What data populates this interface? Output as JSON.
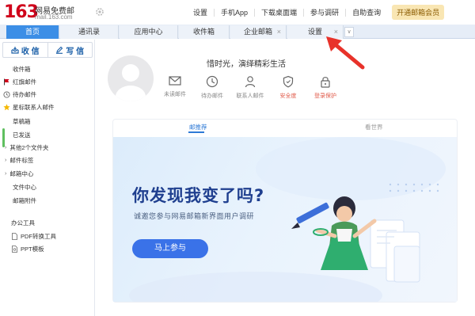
{
  "header": {
    "logo_number": "163",
    "logo_name": "网易免费邮",
    "logo_domain": "mail.163.com",
    "nav": [
      "设置",
      "手机App",
      "下载桌面端",
      "参与调研",
      "自助查询"
    ],
    "vip_label": "开通邮箱会员"
  },
  "tabs": [
    {
      "label": "首页"
    },
    {
      "label": "通讯录"
    },
    {
      "label": "应用中心"
    },
    {
      "label": "收件箱"
    },
    {
      "label": "企业邮箱",
      "close": "×"
    },
    {
      "label": "设置",
      "close": "×"
    }
  ],
  "tab_more": "∨",
  "sidebar": {
    "receive_label": "收 信",
    "write_label": "写 信",
    "folders": [
      "收件箱",
      "红旗邮件",
      "待办邮件",
      "星标联系人邮件",
      "草稿箱",
      "已发送",
      "其他2个文件夹",
      "邮件标签",
      "邮箱中心",
      "文件中心",
      "邮箱附件"
    ],
    "tools_title": "办公工具",
    "tools": [
      "PDF转换工具",
      "PPT模板"
    ]
  },
  "main": {
    "greeting": "惜时光，演绎精彩生活",
    "quick_links": [
      "未读邮件",
      "待办邮件",
      "联系人邮件",
      "安全度",
      "登录保护"
    ],
    "subtabs": [
      "邮推荐",
      "看世界"
    ],
    "banner_title": "你发现我变了吗?",
    "banner_subtitle": "诚邀您参与网易邮箱新界面用户调研",
    "banner_button": "马上参与"
  },
  "colors": {
    "brand_red": "#d0021b",
    "active_tab": "#3c8ee6",
    "link_blue": "#2e7ad6",
    "banner_button": "#3a72e8",
    "annotation_arrow": "#e8322a"
  }
}
